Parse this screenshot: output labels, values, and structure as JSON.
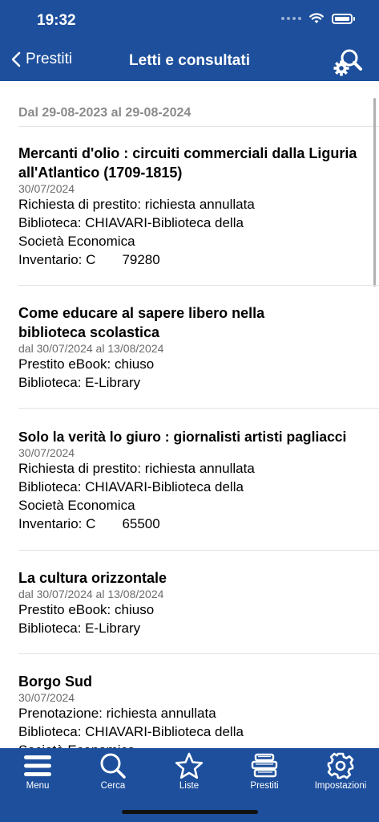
{
  "status_bar": {
    "time": "19:32"
  },
  "nav": {
    "back_label": "Prestiti",
    "title": "Letti e consultati"
  },
  "period": "Dal 29-08-2023 al 29-08-2024",
  "items": [
    {
      "title": "Mercanti d'olio : circuiti commerciali dalla Liguria all'Atlantico (1709-1815)",
      "date": "30/07/2024",
      "lines": [
        "Richiesta di prestito: richiesta annullata",
        "Biblioteca: CHIAVARI-Biblioteca della",
        "Società Economica",
        "Inventario: C       79280"
      ]
    },
    {
      "title": "Come educare al sapere libero nella biblioteca scolastica",
      "date": "dal 30/07/2024 al 13/08/2024",
      "lines": [
        "Prestito eBook: chiuso",
        "Biblioteca: E-Library"
      ]
    },
    {
      "title": "Solo la verità lo giuro : giornalisti artisti pagliacci",
      "date": "30/07/2024",
      "lines": [
        "Richiesta di prestito: richiesta annullata",
        "Biblioteca: CHIAVARI-Biblioteca della",
        "Società Economica",
        "Inventario: C       65500"
      ]
    },
    {
      "title": "La cultura orizzontale",
      "date": "dal 30/07/2024 al 13/08/2024",
      "lines": [
        "Prestito eBook: chiuso",
        "Biblioteca: E-Library"
      ]
    },
    {
      "title": "Borgo Sud",
      "date": "30/07/2024",
      "lines": [
        "Prenotazione: richiesta annullata",
        "Biblioteca: CHIAVARI-Biblioteca della",
        "Società Economica"
      ]
    }
  ],
  "tabs": [
    {
      "label": "Menu",
      "icon": "menu-icon"
    },
    {
      "label": "Cerca",
      "icon": "search-icon"
    },
    {
      "label": "Liste",
      "icon": "star-icon"
    },
    {
      "label": "Prestiti",
      "icon": "books-icon"
    },
    {
      "label": "Impostazioni",
      "icon": "gear-icon"
    }
  ],
  "colors": {
    "brand": "#1d4f9c",
    "muted_text": "#8a8a8a",
    "divider": "#e3e3e3"
  }
}
